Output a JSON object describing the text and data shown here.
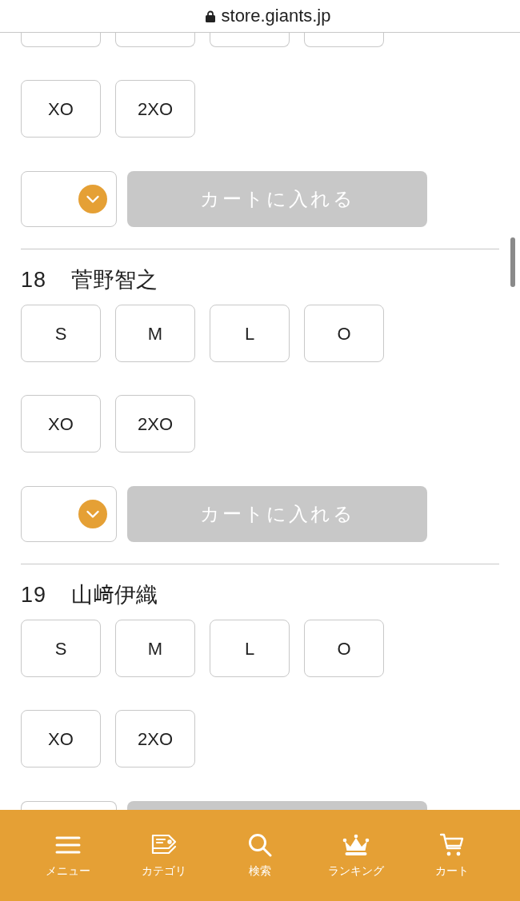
{
  "address_bar": {
    "url": "store.giants.jp"
  },
  "sections": [
    {
      "cut_top": true,
      "cut_bottom": false,
      "size_rows": [
        {
          "sizes": [
            {
              "selected": false
            },
            {
              "selected": false
            },
            {
              "selected": false
            },
            {
              "selected": false
            }
          ]
        },
        {
          "sizes": [
            {
              "label": "XO",
              "selected": false
            },
            {
              "label": "2XO",
              "selected": false
            }
          ]
        }
      ],
      "cart_button": {
        "label": "カートに入れる",
        "disabled": true
      }
    },
    {
      "cut_top": false,
      "cut_bottom": false,
      "number": "18",
      "name": "菅野智之",
      "size_rows": [
        {
          "sizes": [
            {
              "label": "S",
              "selected": false
            },
            {
              "label": "M",
              "selected": false
            },
            {
              "label": "L",
              "selected": false
            },
            {
              "label": "O",
              "selected": false
            }
          ]
        },
        {
          "sizes": [
            {
              "label": "XO",
              "selected": false
            },
            {
              "label": "2XO",
              "selected": false
            }
          ]
        }
      ],
      "cart_button": {
        "label": "カートに入れる",
        "disabled": true
      }
    },
    {
      "cut_top": false,
      "cut_bottom": true,
      "number": "19",
      "name": "山﨑伊織",
      "size_rows": [
        {
          "sizes": [
            {
              "label": "S",
              "selected": false
            },
            {
              "label": "M",
              "selected": false
            },
            {
              "label": "L",
              "selected": false
            },
            {
              "label": "O",
              "selected": false
            }
          ]
        },
        {
          "sizes": [
            {
              "label": "XO",
              "selected": false
            },
            {
              "label": "2XO",
              "selected": false
            }
          ]
        }
      ],
      "cart_button": {
        "disabled": true
      }
    }
  ],
  "bottom_nav": [
    {
      "label": "メニュー"
    },
    {
      "label": "カテゴリ"
    },
    {
      "label": "検索"
    },
    {
      "label": "ランキング"
    },
    {
      "label": "カート"
    }
  ]
}
